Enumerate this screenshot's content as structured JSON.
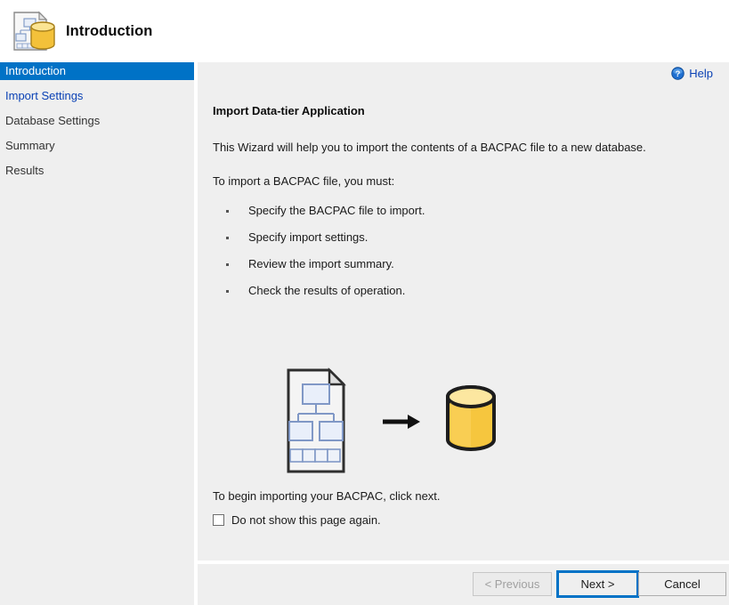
{
  "header": {
    "title": "Introduction",
    "icon": "datatier-application-icon"
  },
  "sidebar": {
    "items": [
      {
        "label": "Introduction",
        "state": "selected"
      },
      {
        "label": "Import Settings",
        "state": "link"
      },
      {
        "label": "Database Settings",
        "state": "normal"
      },
      {
        "label": "Summary",
        "state": "normal"
      },
      {
        "label": "Results",
        "state": "normal"
      }
    ]
  },
  "content": {
    "help_label": "Help",
    "help_icon": "help-circle-icon",
    "page_title": "Import Data-tier Application",
    "intro_paragraph": "This Wizard will help you to import the contents of a BACPAC file to a new database.",
    "must_paragraph": "To import a BACPAC file, you must:",
    "bullets": [
      "Specify the BACPAC file to import.",
      "Specify import settings.",
      "Review the import summary.",
      "Check the results of operation."
    ],
    "illustration": {
      "source_icon": "schema-document-icon",
      "arrow_icon": "arrow-right-icon",
      "target_icon": "database-cylinder-icon"
    },
    "begin_paragraph": "To begin importing your BACPAC, click next.",
    "dont_show_checkbox": {
      "label": "Do not show this page again.",
      "checked": false
    }
  },
  "footer": {
    "previous_label": "< Previous",
    "next_label": "Next >",
    "cancel_label": "Cancel"
  },
  "colors": {
    "accent_blue": "#0072c6",
    "link_blue": "#0a41b5",
    "window_background": "#efefef",
    "header_background": "#ffffff",
    "database_yellow": "#f5c334"
  }
}
